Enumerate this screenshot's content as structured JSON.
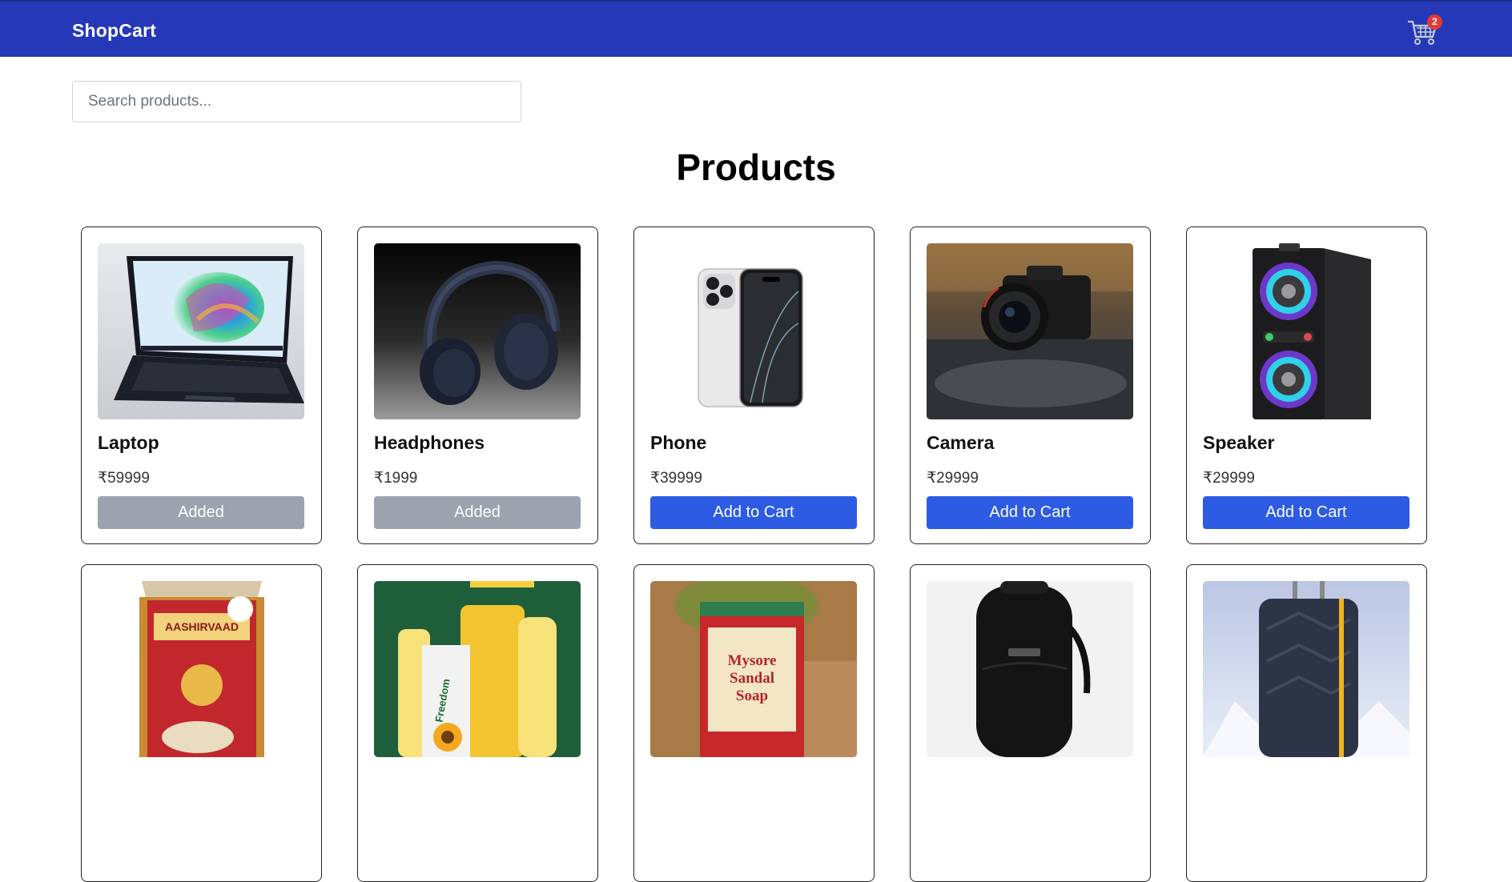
{
  "navbar": {
    "brand": "ShopCart",
    "cart_icon": "cart-icon",
    "cart_count": "2",
    "bg_color": "#2438b8"
  },
  "search": {
    "placeholder": "Search products...",
    "value": ""
  },
  "main": {
    "heading": "Products"
  },
  "products": [
    {
      "name": "Laptop",
      "price": "₹59999",
      "button_label": "Added",
      "added": true,
      "image": "laptop-image"
    },
    {
      "name": "Headphones",
      "price": "₹1999",
      "button_label": "Added",
      "added": true,
      "image": "headphones-image"
    },
    {
      "name": "Phone",
      "price": "₹39999",
      "button_label": "Add to Cart",
      "added": false,
      "image": "phone-image"
    },
    {
      "name": "Camera",
      "price": "₹29999",
      "button_label": "Add to Cart",
      "added": false,
      "image": "camera-image"
    },
    {
      "name": "Speaker",
      "price": "₹29999",
      "button_label": "Add to Cart",
      "added": false,
      "image": "speaker-image"
    },
    {
      "image": "atta-bag-image",
      "logo_text": "AASHIRVAAD"
    },
    {
      "image": "cooking-oil-image",
      "logo_text": "Freedom"
    },
    {
      "image": "sandal-soap-image",
      "logo_text": "Mysore Sandal Soap"
    },
    {
      "image": "backpack-image"
    },
    {
      "image": "suitcase-image"
    }
  ],
  "colors": {
    "accent": "#2d5be3",
    "added": "#9ca3af",
    "badge": "#e53935"
  }
}
